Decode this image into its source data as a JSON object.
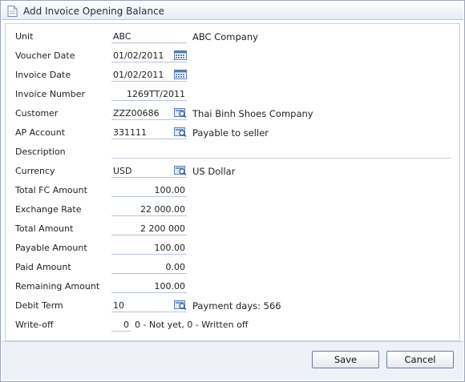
{
  "window": {
    "title": "Add Invoice Opening Balance"
  },
  "form": {
    "unit": {
      "label": "Unit",
      "value": "ABC",
      "description": "ABC Company"
    },
    "voucher_date": {
      "label": "Voucher Date",
      "value": "01/02/2011"
    },
    "invoice_date": {
      "label": "Invoice Date",
      "value": "01/02/2011"
    },
    "invoice_number": {
      "label": "Invoice Number",
      "value": "1269TT/2011"
    },
    "customer": {
      "label": "Customer",
      "value": "ZZZ00686",
      "description": "Thai Binh Shoes Company"
    },
    "ap_account": {
      "label": "AP Account",
      "value": "331111",
      "description": "Payable to seller"
    },
    "description": {
      "label": "Description",
      "value": ""
    },
    "currency": {
      "label": "Currency",
      "value": "USD",
      "description": "US Dollar"
    },
    "total_fc_amount": {
      "label": "Total FC Amount",
      "value": "100.00"
    },
    "exchange_rate": {
      "label": "Exchange Rate",
      "value": "22 000.00"
    },
    "total_amount": {
      "label": "Total Amount",
      "value": "2 200 000"
    },
    "payable_amount": {
      "label": "Payable Amount",
      "value": "100.00"
    },
    "paid_amount": {
      "label": "Paid Amount",
      "value": "0.00"
    },
    "remaining_amount": {
      "label": "Remaining Amount",
      "value": "100.00"
    },
    "debit_term": {
      "label": "Debit Term",
      "value": "10",
      "description": "Payment days: 566"
    },
    "write_off": {
      "label": "Write-off",
      "value": "0",
      "hint": "0 - Not yet, 0 - Written off"
    }
  },
  "buttons": {
    "save": "Save",
    "cancel": "Cancel"
  },
  "icons": {
    "title": "document-icon",
    "calendar": "calendar-icon",
    "lookup": "lookup-icon"
  },
  "colors": {
    "titlebar": "#e8edf5",
    "footer": "#eef2f8",
    "border": "#9aa6b8",
    "field_underline": "#b8c6d8"
  }
}
